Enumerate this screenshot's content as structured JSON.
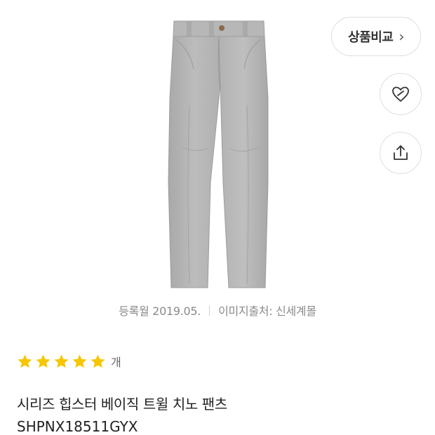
{
  "compare": {
    "label": "상품비교",
    "chevron": "›"
  },
  "actions": {
    "wish_icon": "heart-tag-icon",
    "share_icon": "share-icon"
  },
  "meta": {
    "registered": "등록월 2019.05.",
    "image_source": "이미지출처: 신세계몰"
  },
  "rating": {
    "stars": 5,
    "max": 5,
    "star_color": "#F7C600",
    "count_suffix": "개"
  },
  "product": {
    "title": "시리즈 힙스터 베이직 트윌 치노 팬츠",
    "model": "SHPNX18511GYX"
  },
  "image": {
    "subject": "grey-chino-pants",
    "color": "#B3B3B3"
  }
}
